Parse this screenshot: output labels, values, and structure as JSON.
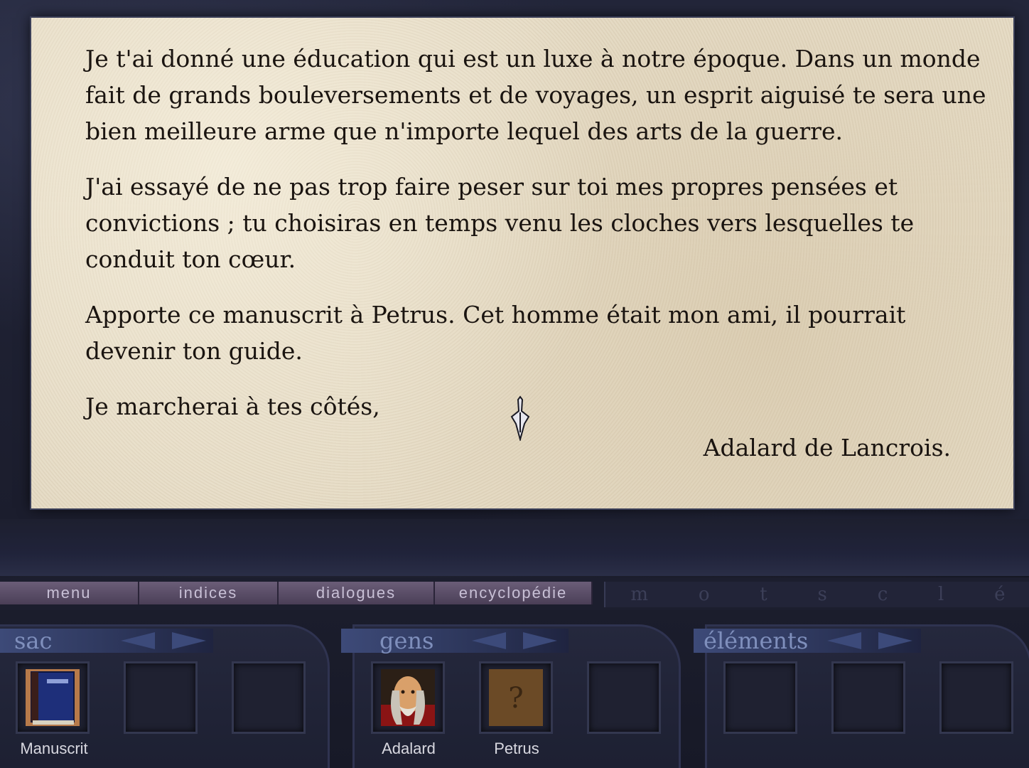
{
  "letter": {
    "paragraphs": [
      "Je t'ai donné une éducation qui est un luxe à notre époque. Dans un monde fait de grands bouleversements et de voyages, un esprit aiguisé te sera une bien meilleure arme que n'importe lequel des arts de la guerre.",
      "J'ai essayé de ne pas trop faire peser sur toi mes propres pensées et convictions ; tu choisiras en temps venu les cloches vers lesquelles te conduit ton cœur.",
      "Apporte ce manuscrit à Petrus. Cet homme était mon ami, il pourrait devenir ton guide.",
      "Je marcherai à tes côtés,"
    ],
    "signature": "Adalard de Lancrois."
  },
  "menu": {
    "tabs": [
      "menu",
      "indices",
      "dialogues",
      "encyclopédie"
    ],
    "keywords_letters": [
      "m",
      "o",
      "t",
      "s",
      "c",
      "l",
      "é"
    ]
  },
  "panels": {
    "sac": {
      "title": "sac",
      "items": [
        "Manuscrit"
      ]
    },
    "gens": {
      "title": "gens",
      "items": [
        "Adalard",
        "Petrus"
      ]
    },
    "elements": {
      "title": "éléments",
      "items": []
    }
  },
  "icons": {
    "cursor": "dagger-cursor-icon",
    "prev": "left-arrow-icon",
    "next": "right-arrow-icon"
  }
}
